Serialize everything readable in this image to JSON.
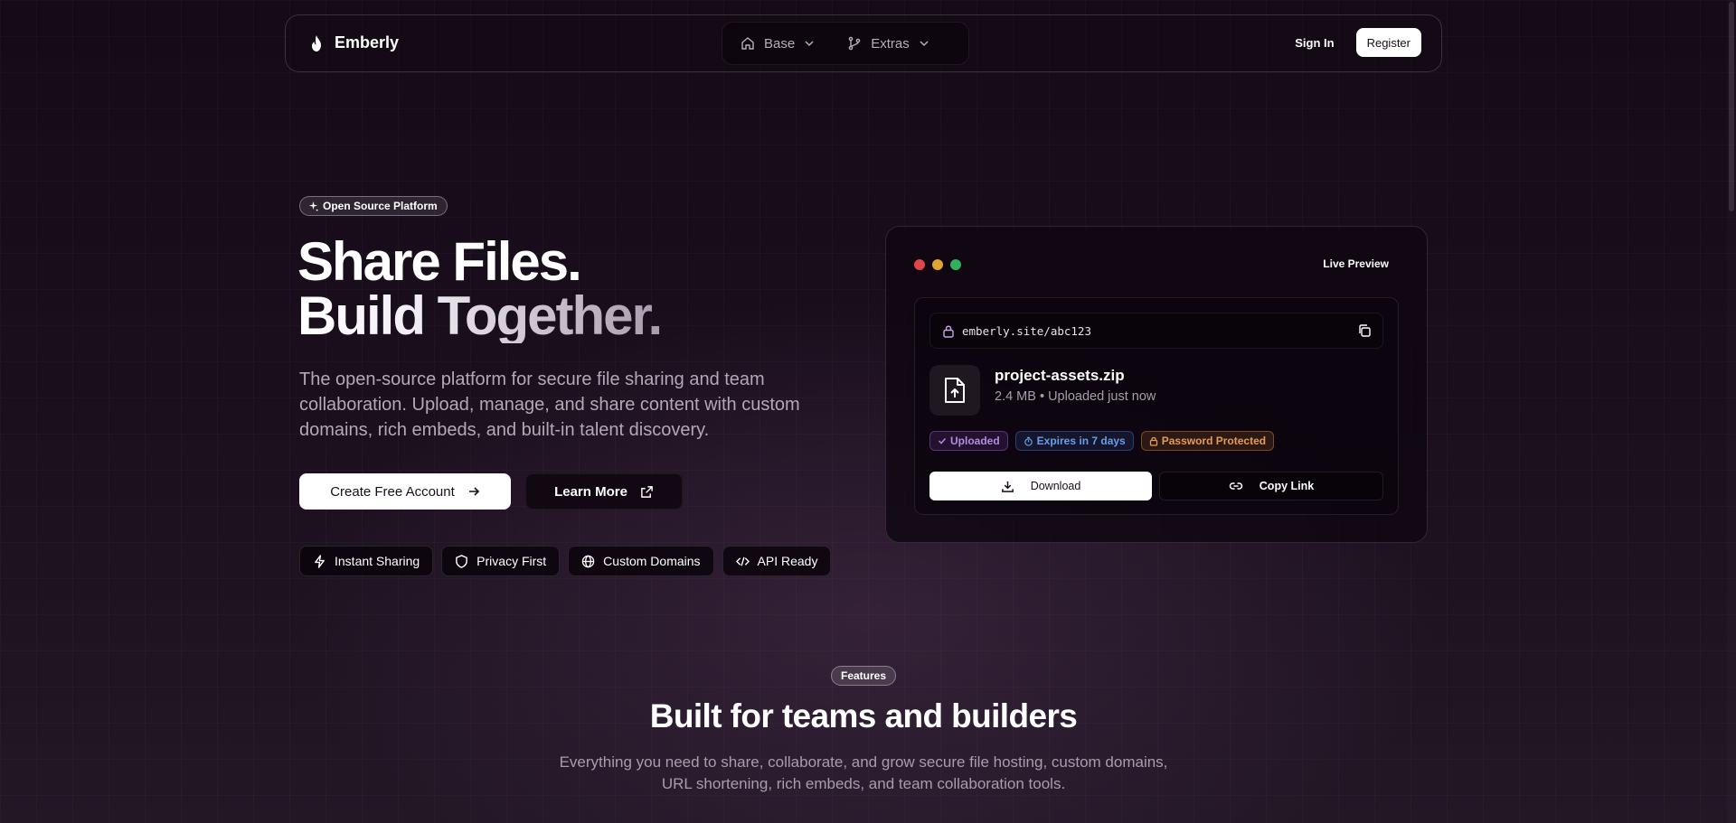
{
  "nav": {
    "brand": "Emberly",
    "menus": [
      {
        "label": "Base",
        "icon": "home-icon"
      },
      {
        "label": "Extras",
        "icon": "git-branch-icon"
      }
    ],
    "sign_in": "Sign In",
    "register": "Register"
  },
  "hero": {
    "badge": "Open Source Platform",
    "title_line1": "Share Files.",
    "title_line2": "Build Together.",
    "lead": "The open-source platform for secure file sharing and team collaboration. Upload, manage, and share content with custom domains, rich embeds, and built-in talent discovery.",
    "primary_cta": "Create Free Account",
    "secondary_cta": "Learn More",
    "pills": [
      {
        "label": "Instant Sharing",
        "icon": "zap-icon"
      },
      {
        "label": "Privacy First",
        "icon": "shield-icon"
      },
      {
        "label": "Custom Domains",
        "icon": "globe-icon"
      },
      {
        "label": "API Ready",
        "icon": "code-icon"
      }
    ]
  },
  "preview": {
    "title": "Live Preview",
    "window_dot_colors": [
      "#e0454a",
      "#e0a52c",
      "#2eb35a"
    ],
    "url": "emberly.site/abc123",
    "file_name": "project-assets.zip",
    "file_meta": "2.4 MB • Uploaded just now",
    "tags": [
      {
        "label": "Uploaded",
        "icon": "check-icon",
        "color": "#b58ae0"
      },
      {
        "label": "Expires in 7 days",
        "icon": "timer-icon",
        "color": "#6a9ee8"
      },
      {
        "label": "Password Protected",
        "icon": "lock-icon",
        "color": "#e49b57"
      }
    ],
    "download": "Download",
    "copy_link": "Copy Link"
  },
  "features": {
    "badge": "Features",
    "title": "Built for teams and builders",
    "subtitle": "Everything you need to share, collaborate, and grow secure file hosting, custom domains, URL shortening, rich embeds, and team collaboration tools."
  }
}
